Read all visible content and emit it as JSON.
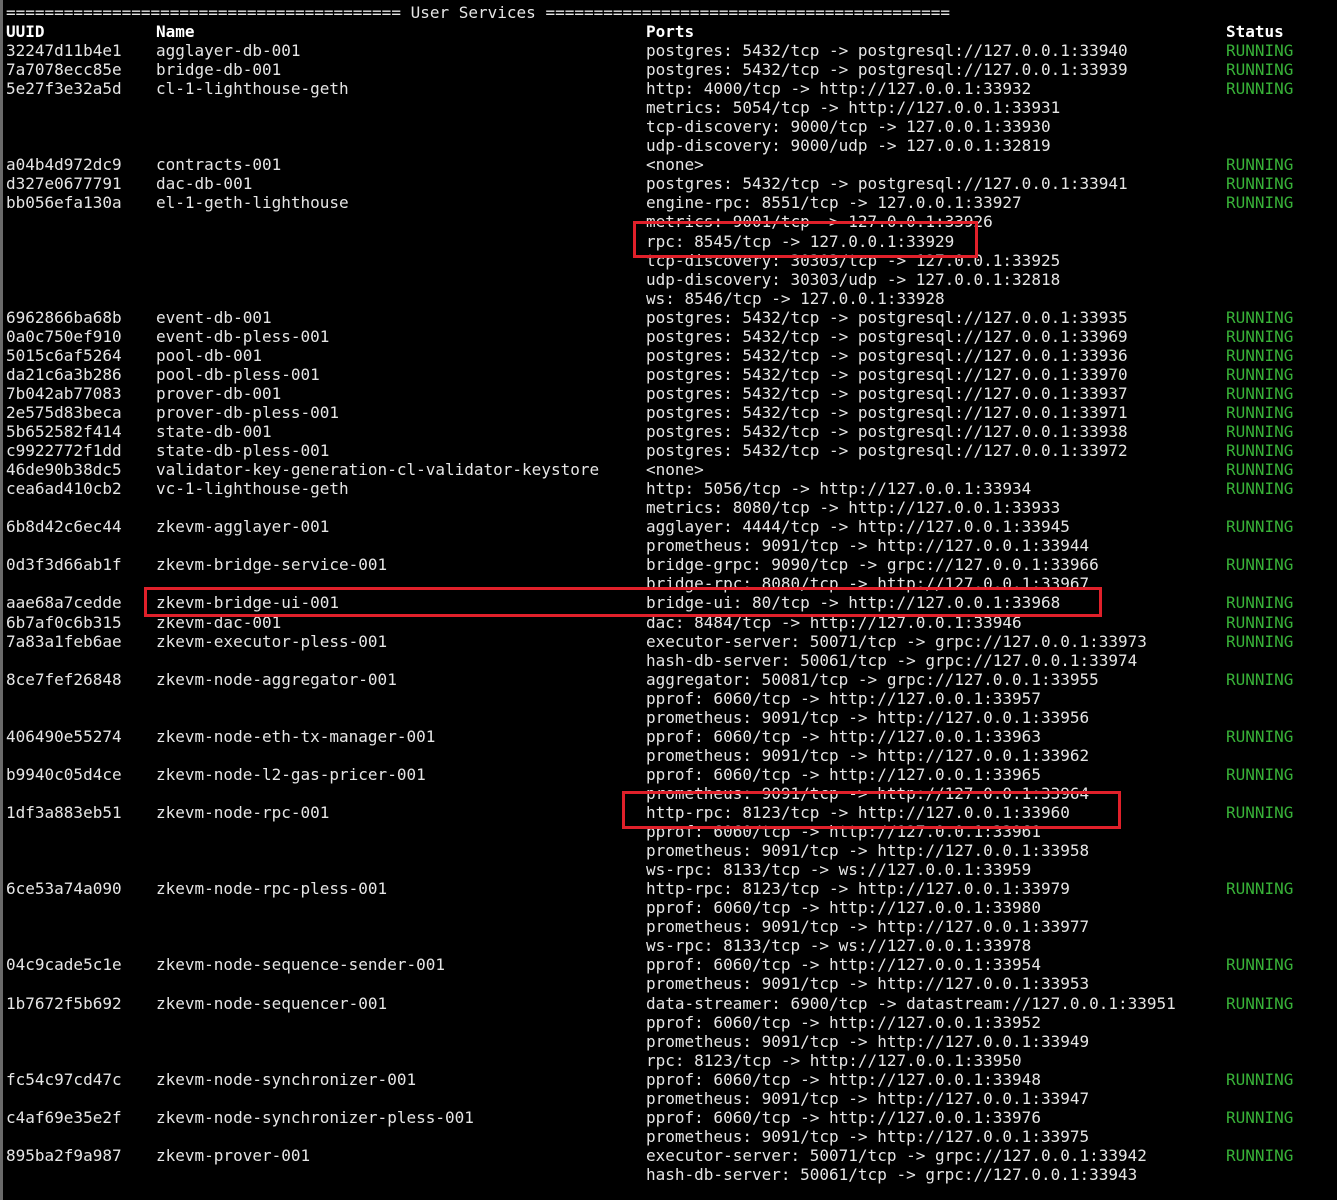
{
  "title": "========================================= User Services ==========================================",
  "headers": {
    "uuid": "UUID",
    "name": "Name",
    "ports": "Ports",
    "status": "Status"
  },
  "services": [
    {
      "uuid": "32247d11b4e1",
      "name": "agglayer-db-001",
      "ports": [
        "postgres: 5432/tcp -> postgresql://127.0.0.1:33940"
      ],
      "status": "RUNNING"
    },
    {
      "uuid": "7a7078ecc85e",
      "name": "bridge-db-001",
      "ports": [
        "postgres: 5432/tcp -> postgresql://127.0.0.1:33939"
      ],
      "status": "RUNNING"
    },
    {
      "uuid": "5e27f3e32a5d",
      "name": "cl-1-lighthouse-geth",
      "ports": [
        "http: 4000/tcp -> http://127.0.0.1:33932",
        "metrics: 5054/tcp -> http://127.0.0.1:33931",
        "tcp-discovery: 9000/tcp -> 127.0.0.1:33930",
        "udp-discovery: 9000/udp -> 127.0.0.1:32819"
      ],
      "status": "RUNNING"
    },
    {
      "uuid": "a04b4d972dc9",
      "name": "contracts-001",
      "ports": [
        "<none>"
      ],
      "status": "RUNNING"
    },
    {
      "uuid": "d327e0677791",
      "name": "dac-db-001",
      "ports": [
        "postgres: 5432/tcp -> postgresql://127.0.0.1:33941"
      ],
      "status": "RUNNING"
    },
    {
      "uuid": "bb056efa130a",
      "name": "el-1-geth-lighthouse",
      "ports": [
        "engine-rpc: 8551/tcp -> 127.0.0.1:33927",
        "metrics: 9001/tcp -> 127.0.0.1:33926",
        "rpc: 8545/tcp -> 127.0.0.1:33929",
        "tcp-discovery: 30303/tcp -> 127.0.0.1:33925",
        "udp-discovery: 30303/udp -> 127.0.0.1:32818",
        "ws: 8546/tcp -> 127.0.0.1:33928"
      ],
      "status": "RUNNING"
    },
    {
      "uuid": "6962866ba68b",
      "name": "event-db-001",
      "ports": [
        "postgres: 5432/tcp -> postgresql://127.0.0.1:33935"
      ],
      "status": "RUNNING"
    },
    {
      "uuid": "0a0c750ef910",
      "name": "event-db-pless-001",
      "ports": [
        "postgres: 5432/tcp -> postgresql://127.0.0.1:33969"
      ],
      "status": "RUNNING"
    },
    {
      "uuid": "5015c6af5264",
      "name": "pool-db-001",
      "ports": [
        "postgres: 5432/tcp -> postgresql://127.0.0.1:33936"
      ],
      "status": "RUNNING"
    },
    {
      "uuid": "da21c6a3b286",
      "name": "pool-db-pless-001",
      "ports": [
        "postgres: 5432/tcp -> postgresql://127.0.0.1:33970"
      ],
      "status": "RUNNING"
    },
    {
      "uuid": "7b042ab77083",
      "name": "prover-db-001",
      "ports": [
        "postgres: 5432/tcp -> postgresql://127.0.0.1:33937"
      ],
      "status": "RUNNING"
    },
    {
      "uuid": "2e575d83beca",
      "name": "prover-db-pless-001",
      "ports": [
        "postgres: 5432/tcp -> postgresql://127.0.0.1:33971"
      ],
      "status": "RUNNING"
    },
    {
      "uuid": "5b652582f414",
      "name": "state-db-001",
      "ports": [
        "postgres: 5432/tcp -> postgresql://127.0.0.1:33938"
      ],
      "status": "RUNNING"
    },
    {
      "uuid": "c9922772f1dd",
      "name": "state-db-pless-001",
      "ports": [
        "postgres: 5432/tcp -> postgresql://127.0.0.1:33972"
      ],
      "status": "RUNNING"
    },
    {
      "uuid": "46de90b38dc5",
      "name": "validator-key-generation-cl-validator-keystore",
      "ports": [
        "<none>"
      ],
      "status": "RUNNING"
    },
    {
      "uuid": "cea6ad410cb2",
      "name": "vc-1-lighthouse-geth",
      "ports": [
        "http: 5056/tcp -> http://127.0.0.1:33934",
        "metrics: 8080/tcp -> http://127.0.0.1:33933"
      ],
      "status": "RUNNING"
    },
    {
      "uuid": "6b8d42c6ec44",
      "name": "zkevm-agglayer-001",
      "ports": [
        "agglayer: 4444/tcp -> http://127.0.0.1:33945",
        "prometheus: 9091/tcp -> http://127.0.0.1:33944"
      ],
      "status": "RUNNING"
    },
    {
      "uuid": "0d3f3d66ab1f",
      "name": "zkevm-bridge-service-001",
      "ports": [
        "bridge-grpc: 9090/tcp -> grpc://127.0.0.1:33966",
        "bridge-rpc: 8080/tcp -> http://127.0.0.1:33967"
      ],
      "status": "RUNNING"
    },
    {
      "uuid": "aae68a7cedde",
      "name": "zkevm-bridge-ui-001",
      "ports": [
        "bridge-ui: 80/tcp -> http://127.0.0.1:33968"
      ],
      "status": "RUNNING"
    },
    {
      "uuid": "6b7af0c6b315",
      "name": "zkevm-dac-001",
      "ports": [
        "dac: 8484/tcp -> http://127.0.0.1:33946"
      ],
      "status": "RUNNING"
    },
    {
      "uuid": "7a83a1feb6ae",
      "name": "zkevm-executor-pless-001",
      "ports": [
        "executor-server: 50071/tcp -> grpc://127.0.0.1:33973",
        "hash-db-server: 50061/tcp -> grpc://127.0.0.1:33974"
      ],
      "status": "RUNNING"
    },
    {
      "uuid": "8ce7fef26848",
      "name": "zkevm-node-aggregator-001",
      "ports": [
        "aggregator: 50081/tcp -> grpc://127.0.0.1:33955",
        "pprof: 6060/tcp -> http://127.0.0.1:33957",
        "prometheus: 9091/tcp -> http://127.0.0.1:33956"
      ],
      "status": "RUNNING"
    },
    {
      "uuid": "406490e55274",
      "name": "zkevm-node-eth-tx-manager-001",
      "ports": [
        "pprof: 6060/tcp -> http://127.0.0.1:33963",
        "prometheus: 9091/tcp -> http://127.0.0.1:33962"
      ],
      "status": "RUNNING"
    },
    {
      "uuid": "b9940c05d4ce",
      "name": "zkevm-node-l2-gas-pricer-001",
      "ports": [
        "pprof: 6060/tcp -> http://127.0.0.1:33965",
        "prometheus: 9091/tcp -> http://127.0.0.1:33964"
      ],
      "status": "RUNNING"
    },
    {
      "uuid": "1df3a883eb51",
      "name": "zkevm-node-rpc-001",
      "ports": [
        "http-rpc: 8123/tcp -> http://127.0.0.1:33960",
        "pprof: 6060/tcp -> http://127.0.0.1:33961",
        "prometheus: 9091/tcp -> http://127.0.0.1:33958",
        "ws-rpc: 8133/tcp -> ws://127.0.0.1:33959"
      ],
      "status": "RUNNING"
    },
    {
      "uuid": "6ce53a74a090",
      "name": "zkevm-node-rpc-pless-001",
      "ports": [
        "http-rpc: 8123/tcp -> http://127.0.0.1:33979",
        "pprof: 6060/tcp -> http://127.0.0.1:33980",
        "prometheus: 9091/tcp -> http://127.0.0.1:33977",
        "ws-rpc: 8133/tcp -> ws://127.0.0.1:33978"
      ],
      "status": "RUNNING"
    },
    {
      "uuid": "04c9cade5c1e",
      "name": "zkevm-node-sequence-sender-001",
      "ports": [
        "pprof: 6060/tcp -> http://127.0.0.1:33954",
        "prometheus: 9091/tcp -> http://127.0.0.1:33953"
      ],
      "status": "RUNNING"
    },
    {
      "uuid": "1b7672f5b692",
      "name": "zkevm-node-sequencer-001",
      "ports": [
        "data-streamer: 6900/tcp -> datastream://127.0.0.1:33951",
        "pprof: 6060/tcp -> http://127.0.0.1:33952",
        "prometheus: 9091/tcp -> http://127.0.0.1:33949",
        "rpc: 8123/tcp -> http://127.0.0.1:33950"
      ],
      "status": "RUNNING"
    },
    {
      "uuid": "fc54c97cd47c",
      "name": "zkevm-node-synchronizer-001",
      "ports": [
        "pprof: 6060/tcp -> http://127.0.0.1:33948",
        "prometheus: 9091/tcp -> http://127.0.0.1:33947"
      ],
      "status": "RUNNING"
    },
    {
      "uuid": "c4af69e35e2f",
      "name": "zkevm-node-synchronizer-pless-001",
      "ports": [
        "pprof: 6060/tcp -> http://127.0.0.1:33976",
        "prometheus: 9091/tcp -> http://127.0.0.1:33975"
      ],
      "status": "RUNNING"
    },
    {
      "uuid": "895ba2f9a987",
      "name": "zkevm-prover-001",
      "ports": [
        "executor-server: 50071/tcp -> grpc://127.0.0.1:33942",
        "hash-db-server: 50061/tcp -> grpc://127.0.0.1:33943"
      ],
      "status": "RUNNING"
    }
  ],
  "colors": {
    "background": "#000000",
    "text": "#e6e6e6",
    "status": "#38b238",
    "highlight": "#e0202a"
  }
}
